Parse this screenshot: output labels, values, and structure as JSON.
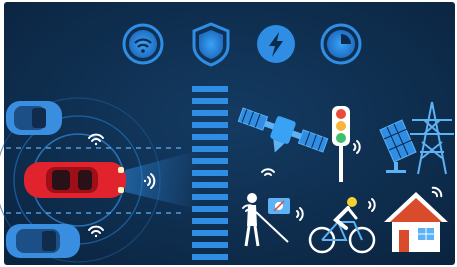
{
  "scene": {
    "description_label": "",
    "colors": {
      "background": "#0c2a4a",
      "accent": "#2f8de4",
      "accent_light": "#5db1f5",
      "car_red": "#e0232c",
      "car_blue": "#3a8ee0",
      "white": "#ffffff",
      "traffic_red": "#e84a3d",
      "traffic_yellow": "#f5b43a",
      "traffic_green": "#3fbf6a",
      "house_red": "#d94b2b"
    },
    "top_icons": [
      "wifi-icon",
      "shield-icon",
      "lightning-icon",
      "clock-icon"
    ],
    "scene_icons": [
      "vehicle-red-car",
      "vehicle-blue-car-top",
      "vehicle-blue-car-bottom",
      "satellite-icon",
      "traffic-light-icon",
      "solar-panel-icon",
      "power-tower-icon",
      "pedestrian-cane-icon",
      "cyclist-icon",
      "house-icon",
      "crosswalk"
    ]
  }
}
